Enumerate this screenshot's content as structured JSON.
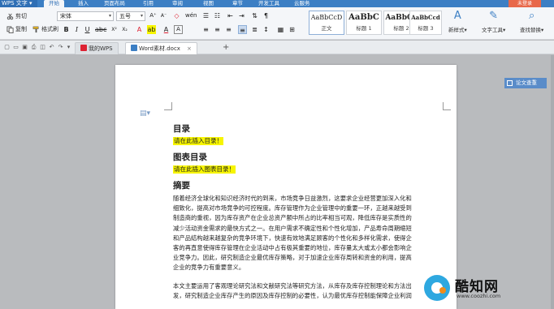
{
  "app": {
    "name": "WPS 文字",
    "login_label": "未登录"
  },
  "menu": {
    "tabs": [
      "开始",
      "插入",
      "页面布局",
      "引用",
      "审阅",
      "视图",
      "章节",
      "开发工具",
      "云服务"
    ],
    "active": "开始"
  },
  "ribbon": {
    "clipboard": {
      "cut": "剪切",
      "copy": "复制",
      "format_painter": "格式刷",
      "paste": "粘贴"
    },
    "font": {
      "family": "宋体",
      "size": "五号"
    },
    "styles": [
      {
        "sample": "AaBbCcD",
        "label": "正文"
      },
      {
        "sample": "AaBbC",
        "label": "标题 1"
      },
      {
        "sample": "AaBbCc",
        "label": "标题 2"
      },
      {
        "sample": "AaBbCcd",
        "label": "标题 3"
      }
    ],
    "new_style": "新样式",
    "text_tools": "文字工具",
    "find_replace": "查找替换"
  },
  "doc_tabs": [
    {
      "label": "我的WPS",
      "active": false
    },
    {
      "label": "Word素材.docx",
      "active": true
    }
  ],
  "document": {
    "toc_heading": "目录",
    "toc_placeholder": "请在此插入目录！",
    "figure_heading": "图表目录",
    "figure_placeholder": "请在此插入图表目录！",
    "abstract_heading": "摘要",
    "abstract_lines": [
      "随着经济全球化和知识经济时代的到来，市场竞争日益激烈，这要求企业经营更加深入化和",
      "细致化，提高对市场竞争的可控程度。库存管理作为企业管理中的重要一环，正越来越受到",
      "制造商的重视，因为库存资产在企业总资产额中所占的比率相当可观，降低库存是实质性的",
      "减少活动资金需求的最快方式之一。在用户需求不确定性和个性化增加，产品寿命周期缩短",
      "和产品结构越来越复杂的竞争环境下，快速有效地满足顾客的个性化和多样化需求，使得企",
      "客的再直意使得库存管理在企业活动中占有极其重要的地位，库存量太大或太小都会影响企",
      "业竞争力。因此，研究制造企业最优库存策略，对于加速企业库存周转和资金的利用，提高",
      "企业的竞争力有重要意义。"
    ],
    "second_paragraph_lines": [
      "本文主要运用了客观理论研究法和文献研究法等研究方法，从库存及库存控制理论和方法出",
      "发，研究制造企业库存产生的原因及库存控制的必要性，认为最优库存控制能保障企业利润"
    ]
  },
  "side_button": "论文查重",
  "watermark": {
    "name": "酷知网",
    "url": "www.coozhi.com"
  }
}
